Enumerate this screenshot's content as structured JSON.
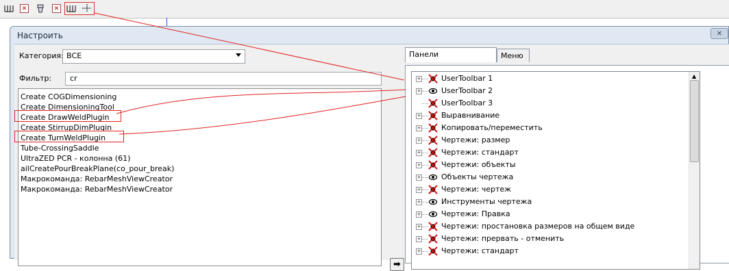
{
  "toolbar": {
    "icons": [
      "dimension-icon",
      "delete-icon",
      "paint-icon",
      "delete-icon",
      "dimension-icon",
      "crosshair-icon"
    ]
  },
  "dialog": {
    "title": "Настроить",
    "close_icon": "close-icon"
  },
  "category": {
    "label": "Категория:",
    "value": "ВСЕ"
  },
  "filter": {
    "label": "Фильтр:",
    "value": "cr"
  },
  "commands": [
    "Create COGDimensioning",
    "Create DimensioningTool",
    "Create DrawWeldPlugin",
    "Create StirrupDimPlugin",
    "Create TurnWeldPlugin",
    "Tube-CrossingSaddle",
    "UltraZED PCR - колонна (61)",
    "ailCreatePourBreakPlane(co_pour_break)",
    "Макрокоманда: RebarMeshViewCreator",
    "Макрокоманда: RebarMeshViewCreator"
  ],
  "tabs": {
    "toolbars": "Панели инструментов",
    "menu": "Меню"
  },
  "toolbars_tree": [
    {
      "label": "UserToolbar 1",
      "icon": "hidden-icon",
      "expandable": true
    },
    {
      "label": "UserToolbar 2",
      "icon": "visible-icon",
      "expandable": true
    },
    {
      "label": "UserToolbar 3",
      "icon": "hidden-icon",
      "expandable": false
    },
    {
      "label": "Выравнивание",
      "icon": "hidden-icon",
      "expandable": true
    },
    {
      "label": "Копировать/переместить",
      "icon": "hidden-icon",
      "expandable": true
    },
    {
      "label": "Чертежи: размер",
      "icon": "hidden-icon",
      "expandable": true
    },
    {
      "label": "Чертежи: стандарт",
      "icon": "hidden-icon",
      "expandable": true
    },
    {
      "label": "Чертежи: объекты",
      "icon": "hidden-icon",
      "expandable": true
    },
    {
      "label": "Объекты чертежа",
      "icon": "visible-icon",
      "expandable": true
    },
    {
      "label": "Чертежи: чертеж",
      "icon": "hidden-icon",
      "expandable": true
    },
    {
      "label": "Инструменты чертежа",
      "icon": "visible-icon",
      "expandable": true
    },
    {
      "label": "Чертежи: Правка",
      "icon": "visible-icon",
      "expandable": true
    },
    {
      "label": "Чертежи: простановка размеров на общем виде",
      "icon": "hidden-icon",
      "expandable": true
    },
    {
      "label": "Чертежи: прервать - отменить",
      "icon": "hidden-icon",
      "expandable": true
    },
    {
      "label": "Чертежи: стандарт",
      "icon": "hidden-icon",
      "expandable": true
    }
  ],
  "add_arrow": "➡",
  "colors": {
    "annotation": "#e02020",
    "dialog_frame": "#dfe8f3",
    "client": "#f0f0f0"
  }
}
